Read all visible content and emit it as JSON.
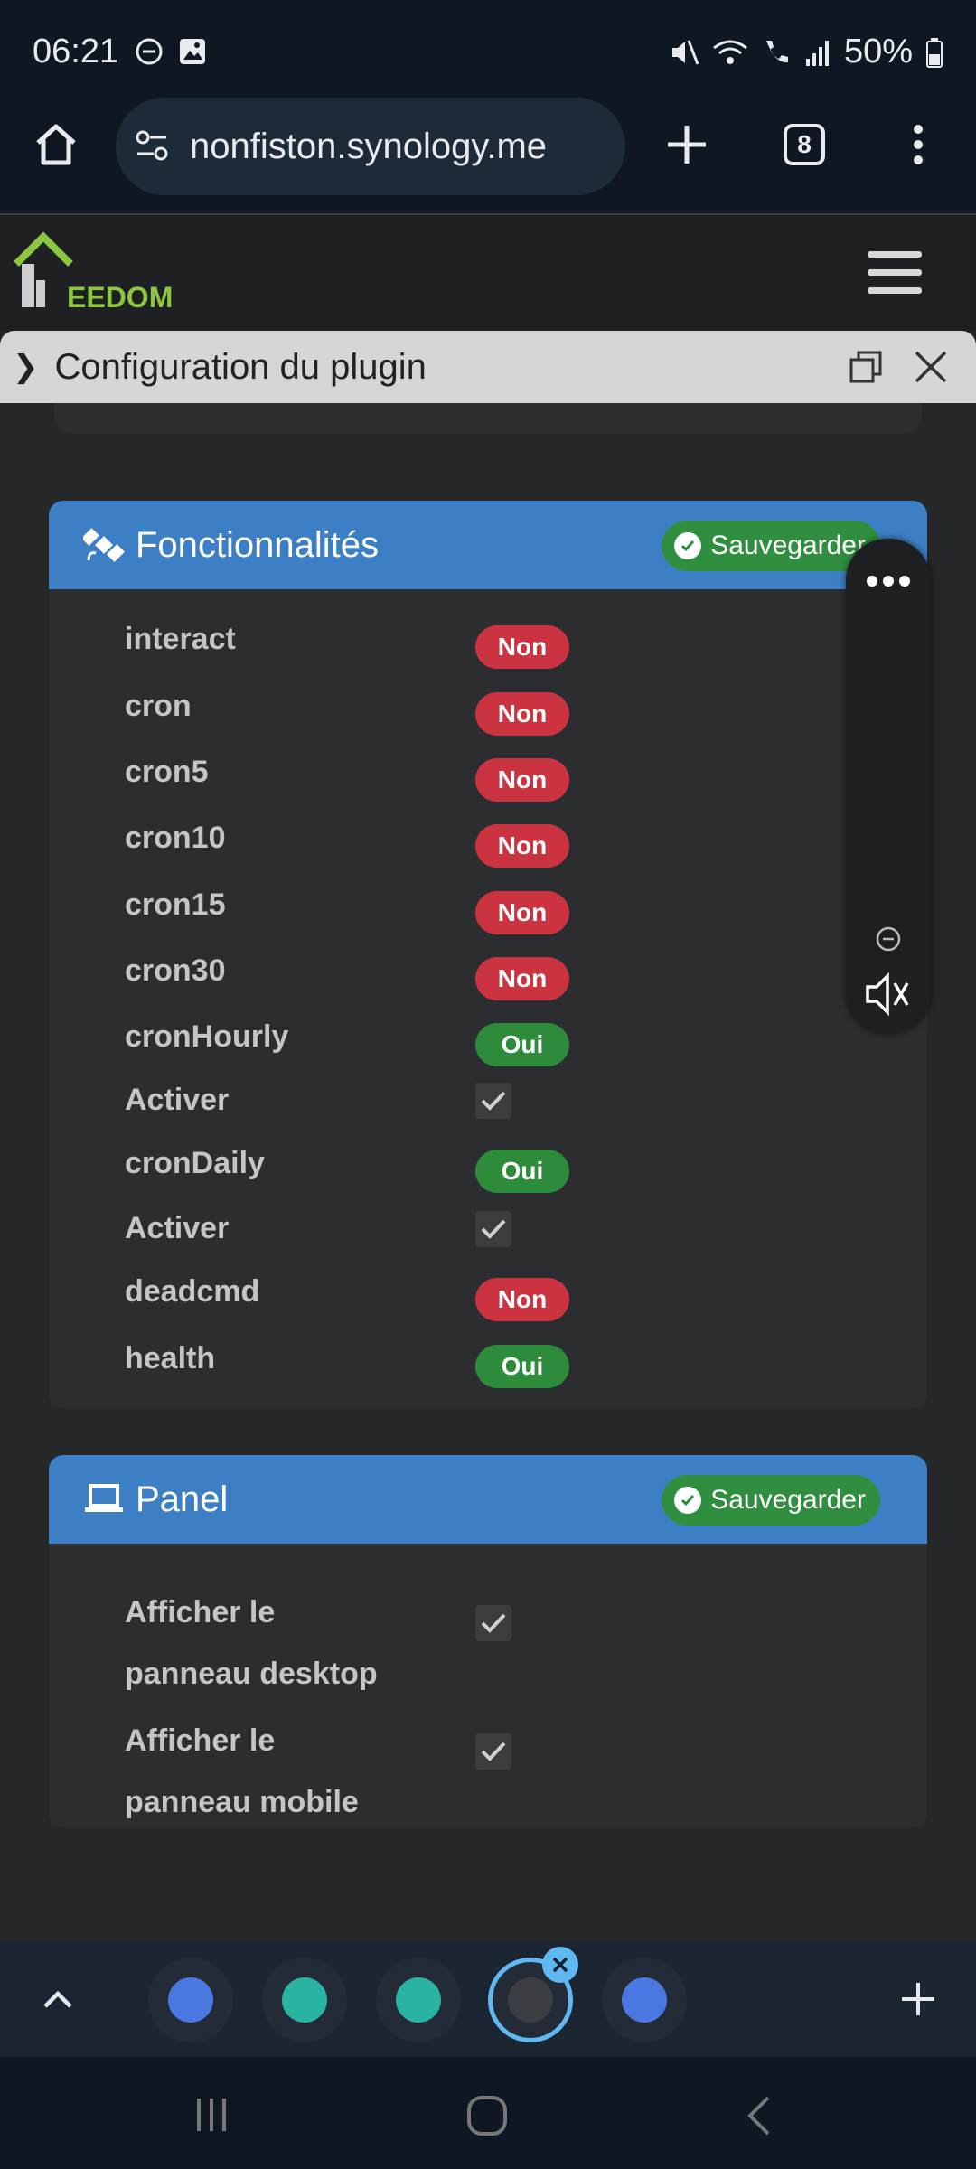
{
  "status": {
    "time": "06:21",
    "battery": "50%"
  },
  "browser": {
    "url": "nonfiston.synology.me",
    "tab_count": "8"
  },
  "app": {
    "logo_text": "EEDOM"
  },
  "modal": {
    "title": "Configuration du plugin"
  },
  "features": {
    "title": "Fonctionnalités",
    "save_label": "Sauvegarder",
    "rows": [
      {
        "label": "interact",
        "kind": "badge",
        "value": "Non",
        "state": "non"
      },
      {
        "label": "cron",
        "kind": "badge",
        "value": "Non",
        "state": "non"
      },
      {
        "label": "cron5",
        "kind": "badge",
        "value": "Non",
        "state": "non"
      },
      {
        "label": "cron10",
        "kind": "badge",
        "value": "Non",
        "state": "non"
      },
      {
        "label": "cron15",
        "kind": "badge",
        "value": "Non",
        "state": "non"
      },
      {
        "label": "cron30",
        "kind": "badge",
        "value": "Non",
        "state": "non"
      },
      {
        "label": "cronHourly",
        "kind": "badge",
        "value": "Oui",
        "state": "oui"
      },
      {
        "label": "Activer",
        "kind": "checkbox",
        "checked": true
      },
      {
        "label": "cronDaily",
        "kind": "badge",
        "value": "Oui",
        "state": "oui"
      },
      {
        "label": "Activer",
        "kind": "checkbox",
        "checked": true
      },
      {
        "label": "deadcmd",
        "kind": "badge",
        "value": "Non",
        "state": "non"
      },
      {
        "label": "health",
        "kind": "badge",
        "value": "Oui",
        "state": "oui"
      }
    ]
  },
  "panel": {
    "title": "Panel",
    "save_label": "Sauvegarder",
    "rows": [
      {
        "label_line1": "Afficher le",
        "label_line2": "panneau desktop",
        "checked": true
      },
      {
        "label_line1": "Afficher le",
        "label_line2": "panneau mobile",
        "checked": true
      }
    ]
  },
  "colors": {
    "header_blue": "#3d7fc4",
    "save_green": "#2f8f3e",
    "non_red": "#cc3340",
    "oui_green": "#2e8b3b",
    "logo_green": "#8dc63f"
  }
}
